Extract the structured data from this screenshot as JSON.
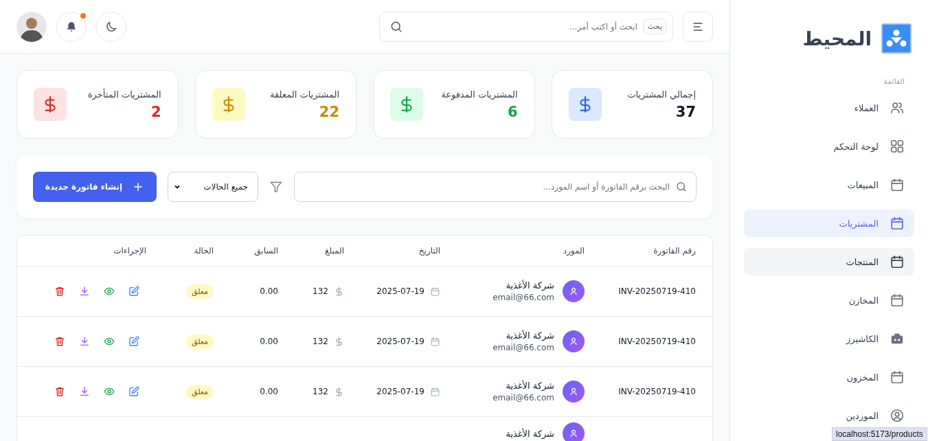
{
  "sidebar": {
    "brand": "المحيط",
    "section_label": "القائمة",
    "items": [
      {
        "label": "العملاء",
        "kind": "users",
        "selected": false,
        "hovered": false
      },
      {
        "label": "لوحة التحكم",
        "kind": "grid",
        "selected": false,
        "hovered": false
      },
      {
        "label": "المبيعات",
        "kind": "calendar",
        "selected": false,
        "hovered": false
      },
      {
        "label": "المشتريات",
        "kind": "calendar",
        "selected": true,
        "hovered": false
      },
      {
        "label": "المنتجات",
        "kind": "calendar",
        "selected": false,
        "hovered": true
      },
      {
        "label": "المخازن",
        "kind": "calendar",
        "selected": false,
        "hovered": false
      },
      {
        "label": "الكاشيرز",
        "kind": "register",
        "selected": false,
        "hovered": false
      },
      {
        "label": "المخزون",
        "kind": "calendar",
        "selected": false,
        "hovered": false
      },
      {
        "label": "الموردين",
        "kind": "user-circle",
        "selected": false,
        "hovered": false
      }
    ]
  },
  "header": {
    "search": {
      "badge": "بحث",
      "placeholder": "ابحث أو اكتب أمر..."
    },
    "notification": true
  },
  "stats": [
    {
      "kind": "total",
      "label": "إجمالي المشتريات",
      "value": "37"
    },
    {
      "kind": "paid",
      "label": "المشتريات المدفوعة",
      "value": "6"
    },
    {
      "kind": "pending",
      "label": "المشتريات المعلقة",
      "value": "22"
    },
    {
      "kind": "late",
      "label": "المشتريات المتأخرة",
      "value": "2"
    }
  ],
  "toolbar": {
    "search_placeholder": "البحث برقم الفاتورة أو اسم المورد...",
    "status_filter": "جميع الحالات",
    "create_button": "إنشاء فاتورة جديدة"
  },
  "table": {
    "columns": [
      "رقم الفاتورة",
      "المورد",
      "التاريخ",
      "المبلغ",
      "السابق",
      "الحالة",
      "الإجراءات"
    ],
    "rows": [
      {
        "invoice": "INV-20250719-410",
        "supplier": "شركة الأغذية",
        "email": "email@66.com",
        "date": "2025-07-19",
        "amount": "132",
        "previous": "0.00",
        "status": "معلق"
      },
      {
        "invoice": "INV-20250719-410",
        "supplier": "شركة الأغذية",
        "email": "email@66.com",
        "date": "2025-07-19",
        "amount": "132",
        "previous": "0.00",
        "status": "معلق"
      },
      {
        "invoice": "INV-20250719-410",
        "supplier": "شركة الأغذية",
        "email": "email@66.com",
        "date": "2025-07-19",
        "amount": "132",
        "previous": "0.00",
        "status": "معلق"
      },
      {
        "supplier": "شركة الأغذية"
      }
    ]
  },
  "browser_status": "localhost:5173/products"
}
